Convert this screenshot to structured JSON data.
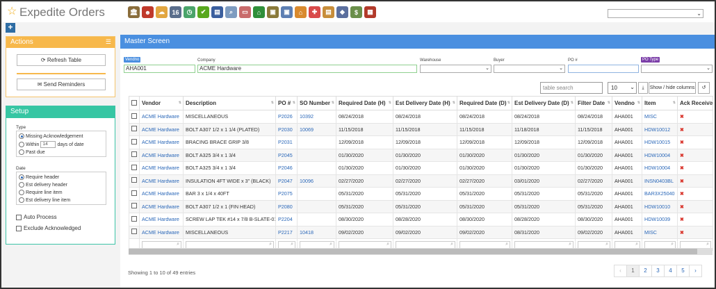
{
  "app": {
    "title": "Expedite Orders"
  },
  "toolbar": {
    "icons": [
      {
        "name": "bank-icon",
        "color": "#8a6d3b",
        "glyph": "🏛"
      },
      {
        "name": "user-icon",
        "color": "#c0392b",
        "glyph": "☻"
      },
      {
        "name": "weather-icon",
        "color": "#e2a640",
        "glyph": "☁"
      },
      {
        "name": "calendar-icon",
        "color": "#5a6e8c",
        "glyph": "16"
      },
      {
        "name": "clock-icon",
        "color": "#4aa46a",
        "glyph": "◷"
      },
      {
        "name": "checkmark-icon",
        "color": "#58a81e",
        "glyph": "✔"
      },
      {
        "name": "ledger-icon",
        "color": "#3b5f9e",
        "glyph": "▤"
      },
      {
        "name": "search-doc-icon",
        "color": "#7e9cc0",
        "glyph": "⌕"
      },
      {
        "name": "screen-icon",
        "color": "#c96b6b",
        "glyph": "▭"
      },
      {
        "name": "basket-icon",
        "color": "#2f8f3a",
        "glyph": "⌂"
      },
      {
        "name": "box-in-icon",
        "color": "#8a7a3a",
        "glyph": "▣"
      },
      {
        "name": "box-out-icon",
        "color": "#5d7fb3",
        "glyph": "▣"
      },
      {
        "name": "cart-icon",
        "color": "#d98a2e",
        "glyph": "⌂"
      },
      {
        "name": "gift-icon",
        "color": "#d94a4a",
        "glyph": "✚"
      },
      {
        "name": "note-icon",
        "color": "#c78d3a",
        "glyph": "▤"
      },
      {
        "name": "tag-icon",
        "color": "#5b6f9e",
        "glyph": "◆"
      },
      {
        "name": "money-icon",
        "color": "#6a8f4a",
        "glyph": "$"
      },
      {
        "name": "bricks-icon",
        "color": "#b23a2a",
        "glyph": "▦"
      }
    ],
    "search_value": ""
  },
  "actions": {
    "title": "Actions",
    "refresh_label": "Refresh Table",
    "reminders_label": "Send Reminders"
  },
  "setup": {
    "title": "Setup",
    "type_label": "Type",
    "type_options": [
      "Missing Acknowledgement",
      "Within",
      "Past due"
    ],
    "within_days": "14",
    "within_suffix": "days of date",
    "date_label": "Date",
    "date_options": [
      "Require header",
      "Est delivery header",
      "Require line item",
      "Est delivery line item"
    ],
    "auto_process": "Auto Process",
    "exclude_ack": "Exclude Acknowledged"
  },
  "master": {
    "title": "Master Screen",
    "filters": {
      "vendno_label": "Vendno",
      "vendno_value": "AHA001",
      "company_label": "Company",
      "company_value": "ACME Hardware",
      "warehouse_label": "Warehouse",
      "buyer_label": "Buyer",
      "po_label": "PO #",
      "potype_label": "PO Type"
    },
    "table_search_placeholder": "table search",
    "page_size": "10",
    "show_hide_label": "Show / hide columns",
    "columns": [
      "Vendor",
      "Description",
      "PO #",
      "SO Number",
      "Required Date (H)",
      "Est Delivery Date (H)",
      "Required Date (D)",
      "Est Delivery Date (D)",
      "Filter Date",
      "Vendno",
      "Item",
      "Ack Received"
    ],
    "rows": [
      [
        "ACME Hardware",
        "MISCELLANEOUS",
        "P2026",
        "10392",
        "08/24/2018",
        "08/24/2018",
        "08/24/2018",
        "08/24/2018",
        "08/24/2018",
        "AHA001",
        "MISC",
        "✖"
      ],
      [
        "ACME Hardware",
        "BOLT A307 1/2 x 1 1/4 (PLATED)",
        "P2030",
        "10069",
        "11/15/2018",
        "11/15/2018",
        "11/15/2018",
        "11/18/2018",
        "11/15/2018",
        "AHA001",
        "HDW10012",
        "✖"
      ],
      [
        "ACME Hardware",
        "BRACING BRACE GRIP 3/8",
        "P2031",
        "",
        "12/09/2018",
        "12/09/2018",
        "12/09/2018",
        "12/09/2018",
        "12/09/2018",
        "AHA001",
        "HDW10015",
        "✖"
      ],
      [
        "ACME Hardware",
        "BOLT A325 3/4 x 1 3/4",
        "P2045",
        "",
        "01/30/2020",
        "01/30/2020",
        "01/30/2020",
        "01/30/2020",
        "01/30/2020",
        "AHA001",
        "HDW10004",
        "✖"
      ],
      [
        "ACME Hardware",
        "BOLT A325 3/4 x 1 3/4",
        "P2046",
        "",
        "01/30/2020",
        "01/30/2020",
        "01/30/2020",
        "01/30/2020",
        "01/30/2020",
        "AHA001",
        "HDW10004",
        "✖"
      ],
      [
        "ACME Hardware",
        "INSULATION 4FT WIDE x 3\" (BLACK)",
        "P2047",
        "10096",
        "02/27/2020",
        "02/27/2020",
        "02/27/2020",
        "03/01/2020",
        "02/27/2020",
        "AHA001",
        "INSN0403BL",
        "✖"
      ],
      [
        "ACME Hardware",
        "BAR 3 x 1/4 x 40FT",
        "P2075",
        "",
        "05/31/2020",
        "05/31/2020",
        "05/31/2020",
        "05/31/2020",
        "05/31/2020",
        "AHA001",
        "BAR3X25040",
        "✖"
      ],
      [
        "ACME Hardware",
        "BOLT A307 1/2 x 1 (FIN HEAD)",
        "P2080",
        "",
        "05/31/2020",
        "05/31/2020",
        "05/31/2020",
        "05/31/2020",
        "05/31/2020",
        "AHA001",
        "HDW10010",
        "✖"
      ],
      [
        "ACME Hardware",
        "SCREW LAP TEK #14 x 7/8 B-SLATE-012",
        "P2204",
        "",
        "08/30/2020",
        "08/28/2020",
        "08/30/2020",
        "08/28/2020",
        "08/30/2020",
        "AHA001",
        "HDW10039",
        "✖"
      ],
      [
        "ACME Hardware",
        "MISCELLANEOUS",
        "P2217",
        "10418",
        "09/02/2020",
        "09/02/2020",
        "09/02/2020",
        "08/31/2020",
        "09/02/2020",
        "AHA001",
        "MISC",
        "✖"
      ]
    ],
    "showing": "Showing 1 to 10 of 49 entries",
    "pages": [
      "‹",
      "1",
      "2",
      "3",
      "4",
      "5",
      "›"
    ]
  }
}
